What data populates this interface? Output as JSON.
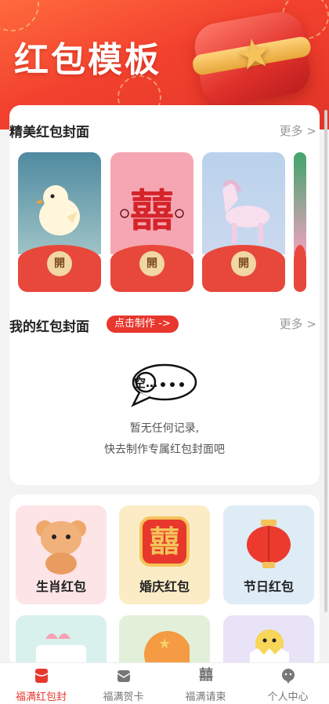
{
  "header": {
    "title": "红包模板"
  },
  "featured": {
    "title": "精美红包封面",
    "more": "更多 >",
    "open_label": "開",
    "items": [
      {
        "icon": "chick-icon"
      },
      {
        "icon": "double-happiness-icon"
      },
      {
        "icon": "horse-icon"
      },
      {
        "icon": "floral-icon"
      }
    ]
  },
  "mine": {
    "title": "我的红包封面",
    "badge": "点击制作 ->",
    "more": "更多 >",
    "empty_bubble": "空…",
    "empty_line1": "暂无任何记录,",
    "empty_line2": "快去制作专属红包封面吧"
  },
  "categories": [
    {
      "label": "生肖红包",
      "icon": "zodiac-mouse-icon"
    },
    {
      "label": "婚庆红包",
      "icon": "wedding-xi-icon",
      "glyph": "囍"
    },
    {
      "label": "节日红包",
      "icon": "lantern-icon"
    },
    {
      "icon": "cake-icon"
    },
    {
      "icon": "coin-icon"
    },
    {
      "icon": "chick-egg-icon"
    }
  ],
  "nav": [
    {
      "label": "福满红包封",
      "active": true
    },
    {
      "label": "福满贺卡"
    },
    {
      "label": "福满请柬",
      "glyph": "囍"
    },
    {
      "label": "个人中心"
    }
  ],
  "colors": {
    "primary": "#e8372d",
    "gold": "#f1d7a4"
  }
}
